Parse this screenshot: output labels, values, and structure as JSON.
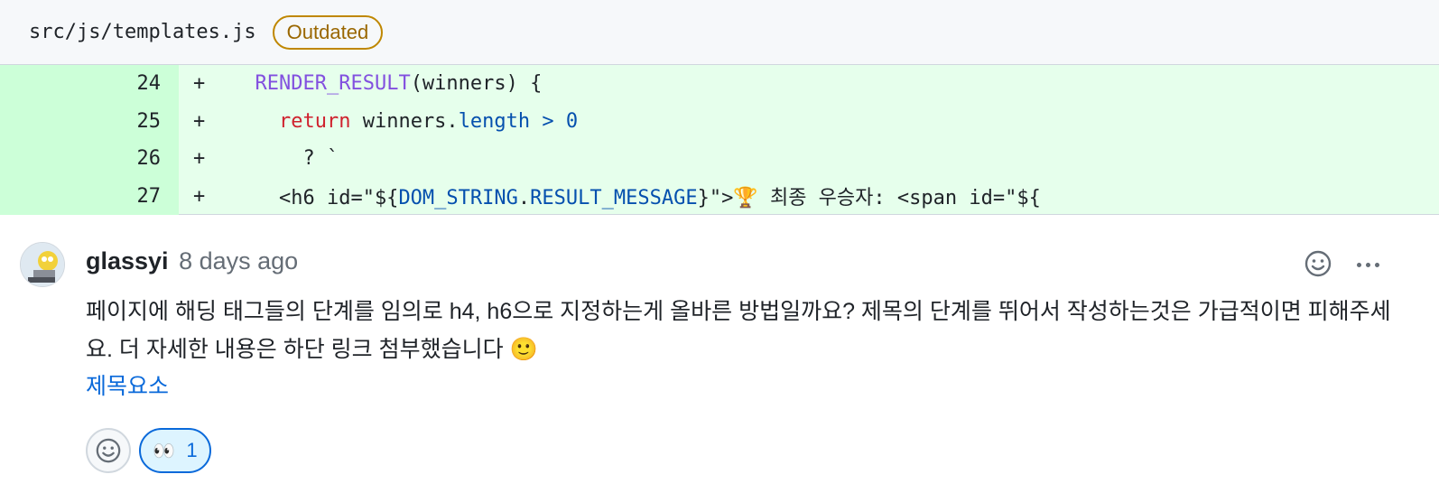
{
  "file": {
    "path": "src/js/templates.js",
    "badge": "Outdated"
  },
  "diff": {
    "sign": "+",
    "lines": [
      {
        "num": "24",
        "parts": [
          {
            "t": "  ",
            "c": ""
          },
          {
            "t": "RENDER_RESULT",
            "c": "tok-fn"
          },
          {
            "t": "(winners) {",
            "c": ""
          }
        ]
      },
      {
        "num": "25",
        "parts": [
          {
            "t": "    ",
            "c": ""
          },
          {
            "t": "return",
            "c": "tok-kw"
          },
          {
            "t": " winners.",
            "c": ""
          },
          {
            "t": "length",
            "c": "tok-prop"
          },
          {
            "t": " ",
            "c": ""
          },
          {
            "t": "> 0",
            "c": "tok-prop"
          }
        ]
      },
      {
        "num": "26",
        "parts": [
          {
            "t": "      ? `",
            "c": ""
          }
        ]
      },
      {
        "num": "27",
        "parts": [
          {
            "t": "    <h6 id=\"${",
            "c": ""
          },
          {
            "t": "DOM_STRING",
            "c": "tok-prop"
          },
          {
            "t": ".",
            "c": ""
          },
          {
            "t": "RESULT_MESSAGE",
            "c": "tok-prop"
          },
          {
            "t": "}\">🏆 최종 우승자: <span id=\"${",
            "c": ""
          }
        ]
      }
    ]
  },
  "comment": {
    "author": "glassyi",
    "time": "8 days ago",
    "body": "페이지에 해딩 태그들의 단계를 임의로 h4, h6으로 지정하는게 올바른 방법일까요? 제목의 단계를 뛰어서 작성하는것은 가급적이면 피해주세요. 더 자세한 내용은 하단 링크 첨부했습니다 🙂",
    "link": "제목요소",
    "reactions": [
      {
        "emoji": "👀",
        "count": "1"
      }
    ]
  },
  "colors": {
    "accent": "#0969da",
    "diff_add_bg": "#e6ffec",
    "badge": "#9a6700"
  }
}
